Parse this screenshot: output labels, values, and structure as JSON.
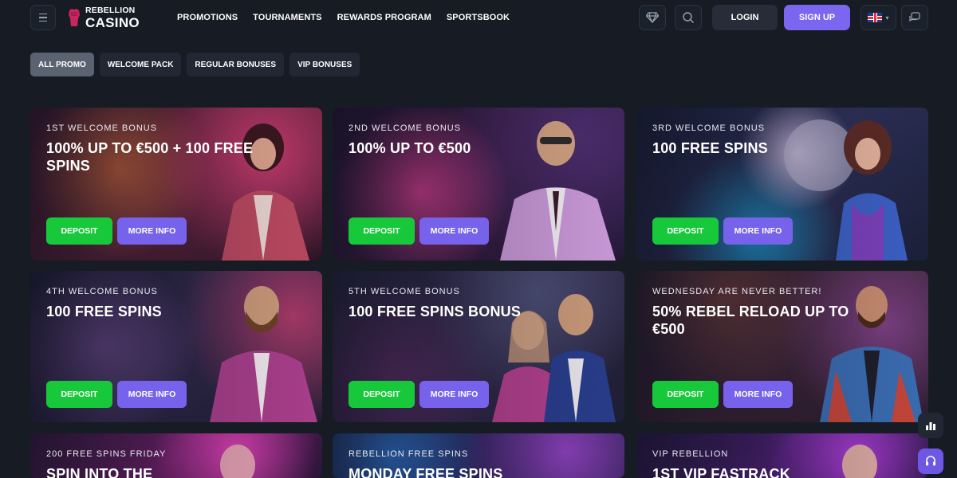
{
  "brand": {
    "line1": "REBELLION",
    "line2": "CASINO",
    "accent": "#c8265f"
  },
  "nav": [
    "PROMOTIONS",
    "TOURNAMENTS",
    "REWARDS PROGRAM",
    "SPORTSBOOK"
  ],
  "header": {
    "login": "LOGIN",
    "signup": "SIGN UP",
    "language_icon": "uk-flag-icon"
  },
  "tabs": [
    {
      "label": "ALL PROMO",
      "active": true
    },
    {
      "label": "WELCOME PACK",
      "active": false
    },
    {
      "label": "REGULAR BONUSES",
      "active": false
    },
    {
      "label": "VIP BONUSES",
      "active": false
    }
  ],
  "cards": [
    {
      "subtitle": "1ST WELCOME BONUS",
      "title": "100% UP TO €500 + 100 FREE SPINS",
      "deposit": "DEPOSIT",
      "more": "MORE INFO"
    },
    {
      "subtitle": "2ND WELCOME BONUS",
      "title": "100% UP TO €500",
      "deposit": "DEPOSIT",
      "more": "MORE INFO"
    },
    {
      "subtitle": "3RD WELCOME BONUS",
      "title": "100 FREE SPINS",
      "deposit": "DEPOSIT",
      "more": "MORE INFO"
    },
    {
      "subtitle": "4TH WELCOME BONUS",
      "title": "100 FREE SPINS",
      "deposit": "DEPOSIT",
      "more": "MORE INFO"
    },
    {
      "subtitle": "5TH WELCOME BONUS",
      "title": "100 FREE SPINS BONUS",
      "deposit": "DEPOSIT",
      "more": "MORE INFO"
    },
    {
      "subtitle": "WEDNESDAY ARE NEVER BETTER!",
      "title": "50% REBEL RELOAD UP TO €500",
      "deposit": "DEPOSIT",
      "more": "MORE INFO"
    },
    {
      "subtitle": "200 FREE SPINS FRIDAY",
      "title": "SPIN INTO THE",
      "deposit": "",
      "more": ""
    },
    {
      "subtitle": "REBELLION FREE SPINS",
      "title": "MONDAY FREE SPINS",
      "deposit": "",
      "more": ""
    },
    {
      "subtitle": "VIP REBELLION",
      "title": "1ST VIP FASTRACK",
      "deposit": "",
      "more": ""
    }
  ],
  "colors": {
    "deposit": "#17c93a",
    "more_info": "#7762ec",
    "signup": "#7b66f0",
    "background": "#161b24"
  }
}
